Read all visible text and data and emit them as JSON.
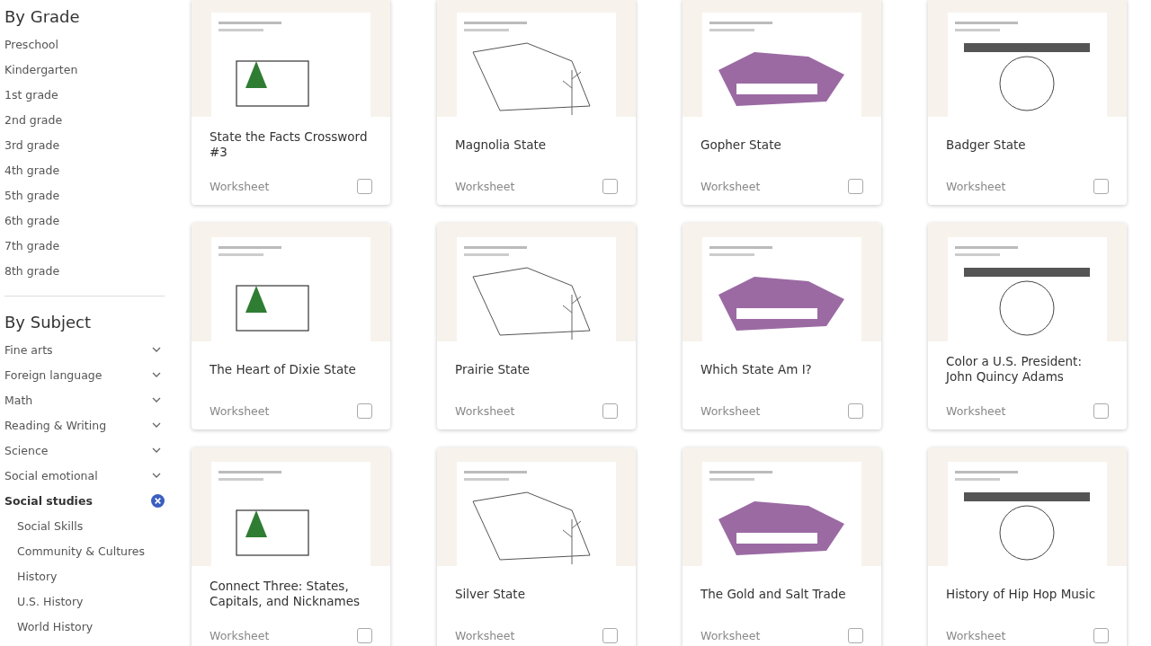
{
  "sidebar": {
    "grade_heading": "By Grade",
    "grades": [
      {
        "label": "Preschool"
      },
      {
        "label": "Kindergarten"
      },
      {
        "label": "1st grade"
      },
      {
        "label": "2nd grade"
      },
      {
        "label": "3rd grade"
      },
      {
        "label": "4th grade"
      },
      {
        "label": "5th grade"
      },
      {
        "label": "6th grade"
      },
      {
        "label": "7th grade"
      },
      {
        "label": "8th grade"
      }
    ],
    "subject_heading": "By Subject",
    "subjects": [
      {
        "label": "Fine arts",
        "selected": false
      },
      {
        "label": "Foreign language",
        "selected": false
      },
      {
        "label": "Math",
        "selected": false
      },
      {
        "label": "Reading & Writing",
        "selected": false
      },
      {
        "label": "Science",
        "selected": false
      },
      {
        "label": "Social emotional",
        "selected": false
      },
      {
        "label": "Social studies",
        "selected": true,
        "children": [
          {
            "label": "Social Skills"
          },
          {
            "label": "Community & Cultures"
          },
          {
            "label": "History"
          },
          {
            "label": "U.S. History"
          },
          {
            "label": "World History"
          }
        ]
      }
    ]
  },
  "cards": [
    {
      "title": "State the Facts Crossword #3",
      "type": "Worksheet",
      "checked": false
    },
    {
      "title": "Magnolia State",
      "type": "Worksheet",
      "checked": false
    },
    {
      "title": "Gopher State",
      "type": "Worksheet",
      "checked": false
    },
    {
      "title": "Badger State",
      "type": "Worksheet",
      "checked": false
    },
    {
      "title": "The Heart of Dixie State",
      "type": "Worksheet",
      "checked": false
    },
    {
      "title": "Prairie State",
      "type": "Worksheet",
      "checked": false
    },
    {
      "title": "Which State Am I?",
      "type": "Worksheet",
      "checked": false
    },
    {
      "title": "Color a U.S. President: John Quincy Adams",
      "type": "Worksheet",
      "checked": false
    },
    {
      "title": "Connect Three: States, Capitals, and Nicknames",
      "type": "Worksheet",
      "checked": false
    },
    {
      "title": "Silver State",
      "type": "Worksheet",
      "checked": false
    },
    {
      "title": "The Gold and Salt Trade",
      "type": "Worksheet",
      "checked": false
    },
    {
      "title": "History of Hip Hop Music",
      "type": "Worksheet",
      "checked": false
    }
  ]
}
